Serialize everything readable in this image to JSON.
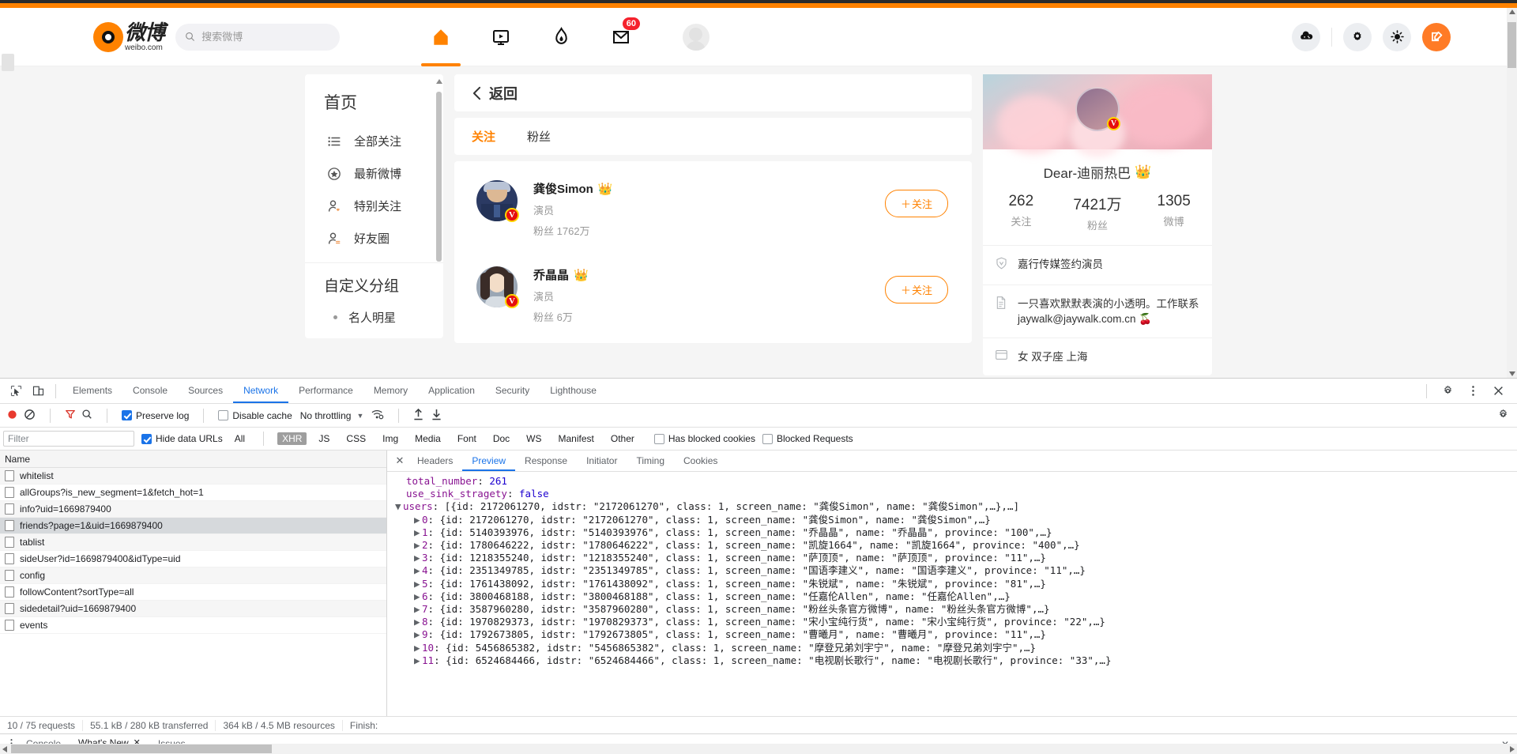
{
  "browser": {
    "brand": {
      "cn": "微博",
      "en": "weibo.com"
    },
    "search": {
      "placeholder": "搜索微博",
      "value": "",
      "icon": "search-icon"
    },
    "nav": [
      {
        "name": "home",
        "icon": "home-icon",
        "active": true
      },
      {
        "name": "video",
        "icon": "video-icon",
        "active": false
      },
      {
        "name": "hot",
        "icon": "flame-icon",
        "active": false
      },
      {
        "name": "messages",
        "icon": "mail-icon",
        "active": false,
        "badge": "60"
      }
    ],
    "tools": [
      {
        "name": "game",
        "icon": "game-cloud-icon"
      },
      {
        "name": "settings",
        "icon": "gear-icon"
      },
      {
        "name": "theme",
        "icon": "sun-icon"
      },
      {
        "name": "compose",
        "icon": "compose-icon"
      }
    ]
  },
  "sidebar": {
    "title": "首页",
    "items": [
      {
        "label": "全部关注",
        "icon": "list-icon"
      },
      {
        "label": "最新微博",
        "icon": "star-circle-icon"
      },
      {
        "label": "特别关注",
        "icon": "user-heart-icon"
      },
      {
        "label": "好友圈",
        "icon": "user-swap-icon"
      }
    ],
    "group_title": "自定义分组",
    "groups": [
      {
        "label": "名人明星",
        "icon": "dot-icon"
      }
    ]
  },
  "main": {
    "back_label": "返回",
    "tabs": [
      {
        "label": "关注",
        "active": true
      },
      {
        "label": "粉丝",
        "active": false
      }
    ],
    "users": [
      {
        "name": "龚俊Simon",
        "crown": "👑",
        "role": "演员",
        "fans_label": "粉丝",
        "fans_value": "1762万",
        "follow_label": "关注",
        "follow_plus": "＋",
        "verified": "V"
      },
      {
        "name": "乔晶晶",
        "crown": "👑",
        "role": "演员",
        "fans_label": "粉丝",
        "fans_value": "6万",
        "follow_label": "关注",
        "follow_plus": "＋",
        "verified": "V"
      }
    ]
  },
  "profile": {
    "name": "Dear-迪丽热巴",
    "crown": "👑",
    "verified": "V",
    "stats": [
      {
        "value": "262",
        "label": "关注"
      },
      {
        "value": "7421万",
        "label": "粉丝"
      },
      {
        "value": "1305",
        "label": "微博"
      }
    ],
    "rows": [
      {
        "icon": "shield-v-icon",
        "text": "嘉行传媒签约演员"
      },
      {
        "icon": "doc-icon",
        "text": "一只喜欢默默表演的小透明。工作联系 jaywalk@jaywalk.com.cn 🍒"
      },
      {
        "icon": "card-icon",
        "text": "女    双子座    上海"
      }
    ]
  },
  "devtools": {
    "panel_tabs": [
      {
        "label": "Elements",
        "active": false
      },
      {
        "label": "Console",
        "active": false
      },
      {
        "label": "Sources",
        "active": false
      },
      {
        "label": "Network",
        "active": true
      },
      {
        "label": "Performance",
        "active": false
      },
      {
        "label": "Memory",
        "active": false
      },
      {
        "label": "Application",
        "active": false
      },
      {
        "label": "Security",
        "active": false
      },
      {
        "label": "Lighthouse",
        "active": false
      }
    ],
    "toolbar": {
      "record_icon": "record-icon",
      "clear_icon": "clear-icon",
      "filter_icon": "funnel-icon",
      "search_icon": "search-icon",
      "preserve_log": "Preserve log",
      "preserve_log_checked": true,
      "disable_cache": "Disable cache",
      "disable_cache_checked": false,
      "throttling": "No throttling",
      "throttling_caret": "▼",
      "wifi_icon": "wifi-settings-icon",
      "import_icon": "upload-icon",
      "export_icon": "download-icon",
      "settings_icon": "gear-icon",
      "more_icon": "kebab-icon",
      "close_icon": "close-icon"
    },
    "filterbar": {
      "placeholder": "Filter",
      "value": "",
      "hide_data_urls": "Hide data URLs",
      "hide_data_urls_checked": true,
      "types": [
        "All",
        "XHR",
        "JS",
        "CSS",
        "Img",
        "Media",
        "Font",
        "Doc",
        "WS",
        "Manifest",
        "Other"
      ],
      "selected_type": "XHR",
      "has_blocked_cookies": "Has blocked cookies",
      "has_blocked_cookies_checked": false,
      "blocked_requests": "Blocked Requests",
      "blocked_requests_checked": false
    },
    "requests": {
      "column": "Name",
      "rows": [
        {
          "name": "whitelist",
          "selected": false
        },
        {
          "name": "allGroups?is_new_segment=1&fetch_hot=1",
          "selected": false
        },
        {
          "name": "info?uid=1669879400",
          "selected": false
        },
        {
          "name": "friends?page=1&uid=1669879400",
          "selected": true
        },
        {
          "name": "tablist",
          "selected": false
        },
        {
          "name": "sideUser?id=1669879400&idType=uid",
          "selected": false
        },
        {
          "name": "config",
          "selected": false
        },
        {
          "name": "followContent?sortType=all",
          "selected": false
        },
        {
          "name": "sidedetail?uid=1669879400",
          "selected": false
        },
        {
          "name": "events",
          "selected": false
        }
      ]
    },
    "detail_tabs": [
      {
        "label": "Headers",
        "active": false
      },
      {
        "label": "Preview",
        "active": true
      },
      {
        "label": "Response",
        "active": false
      },
      {
        "label": "Initiator",
        "active": false
      },
      {
        "label": "Timing",
        "active": false
      },
      {
        "label": "Cookies",
        "active": false
      }
    ],
    "preview": {
      "total_number_key": "total_number",
      "total_number_value": "261",
      "use_sink_key": "use_sink_stragety",
      "use_sink_value": "false",
      "users_key": "users",
      "users_head": ": [{id: 2172061270, idstr: \"2172061270\", class: 1, screen_name: \"龚俊Simon\", name: \"龚俊Simon\",…},…]",
      "rows": [
        {
          "index": "0",
          "text": ": {id: 2172061270, idstr: \"2172061270\", class: 1, screen_name: \"龚俊Simon\", name: \"龚俊Simon\",…}"
        },
        {
          "index": "1",
          "text": ": {id: 5140393976, idstr: \"5140393976\", class: 1, screen_name: \"乔晶晶\", name: \"乔晶晶\", province: \"100\",…}"
        },
        {
          "index": "2",
          "text": ": {id: 1780646222, idstr: \"1780646222\", class: 1, screen_name: \"凯旋1664\", name: \"凯旋1664\", province: \"400\",…}"
        },
        {
          "index": "3",
          "text": ": {id: 1218355240, idstr: \"1218355240\", class: 1, screen_name: \"萨顶顶\", name: \"萨顶顶\", province: \"11\",…}"
        },
        {
          "index": "4",
          "text": ": {id: 2351349785, idstr: \"2351349785\", class: 1, screen_name: \"国语李建义\", name: \"国语李建义\", province: \"11\",…}"
        },
        {
          "index": "5",
          "text": ": {id: 1761438092, idstr: \"1761438092\", class: 1, screen_name: \"朱锐斌\", name: \"朱锐斌\", province: \"81\",…}"
        },
        {
          "index": "6",
          "text": ": {id: 3800468188, idstr: \"3800468188\", class: 1, screen_name: \"任嘉伦Allen\", name: \"任嘉伦Allen\",…}"
        },
        {
          "index": "7",
          "text": ": {id: 3587960280, idstr: \"3587960280\", class: 1, screen_name: \"粉丝头条官方微博\", name: \"粉丝头条官方微博\",…}"
        },
        {
          "index": "8",
          "text": ": {id: 1970829373, idstr: \"1970829373\", class: 1, screen_name: \"宋小宝纯行货\", name: \"宋小宝纯行货\", province: \"22\",…}"
        },
        {
          "index": "9",
          "text": ": {id: 1792673805, idstr: \"1792673805\", class: 1, screen_name: \"曹曦月\", name: \"曹曦月\", province: \"11\",…}"
        },
        {
          "index": "10",
          "text": ": {id: 5456865382, idstr: \"5456865382\", class: 1, screen_name: \"摩登兄弟刘宇宁\", name: \"摩登兄弟刘宇宁\",…}"
        },
        {
          "index": "11",
          "text": ": {id: 6524684466, idstr: \"6524684466\", class: 1, screen_name: \"电视剧长歌行\", name: \"电视剧长歌行\", province: \"33\",…}"
        }
      ]
    },
    "status": {
      "requests": "10 / 75 requests",
      "transferred": "55.1 kB / 280 kB transferred",
      "resources": "364 kB / 4.5 MB resources",
      "finish": "Finish:"
    },
    "drawer": {
      "more_icon": "kebab-icon",
      "tabs": [
        {
          "label": "Console",
          "active": false,
          "closable": false
        },
        {
          "label": "What's New",
          "active": true,
          "closable": true
        },
        {
          "label": "Issues",
          "active": false,
          "closable": false
        }
      ],
      "close_label": "✕"
    }
  }
}
